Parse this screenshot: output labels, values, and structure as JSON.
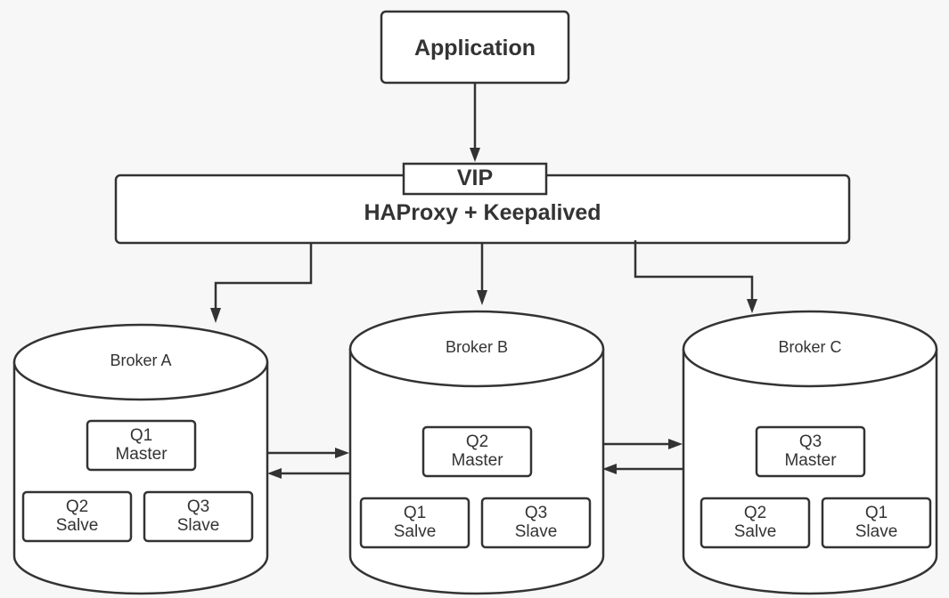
{
  "application": {
    "label": "Application"
  },
  "vip": {
    "label": "VIP"
  },
  "proxy": {
    "label": "HAProxy + Keepalived"
  },
  "brokers": [
    {
      "name": "Broker A",
      "master": {
        "queue": "Q1",
        "role": "Master"
      },
      "replicas": [
        {
          "queue": "Q2",
          "role": "Salve"
        },
        {
          "queue": "Q3",
          "role": "Slave"
        }
      ]
    },
    {
      "name": "Broker B",
      "master": {
        "queue": "Q2",
        "role": "Master"
      },
      "replicas": [
        {
          "queue": "Q1",
          "role": "Salve"
        },
        {
          "queue": "Q3",
          "role": "Slave"
        }
      ]
    },
    {
      "name": "Broker C",
      "master": {
        "queue": "Q3",
        "role": "Master"
      },
      "replicas": [
        {
          "queue": "Q2",
          "role": "Salve"
        },
        {
          "queue": "Q1",
          "role": "Slave"
        }
      ]
    }
  ]
}
